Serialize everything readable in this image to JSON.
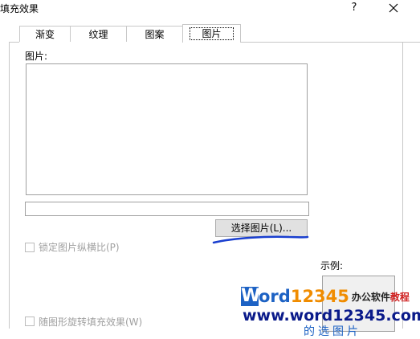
{
  "dialog": {
    "title": "填充效果",
    "help_label": "?",
    "close_label": "✕"
  },
  "tabs": [
    {
      "label": "渐变",
      "selected": false
    },
    {
      "label": "纹理",
      "selected": false
    },
    {
      "label": "图案",
      "selected": false
    },
    {
      "label": "图片",
      "selected": true
    }
  ],
  "picture": {
    "label": "图片:",
    "path_value": "",
    "choose_button": "选择图片(L)..."
  },
  "options": {
    "lock_aspect_label": "锁定图片纵横比(P)",
    "lock_aspect_checked": false,
    "rotate_with_shape_label": "随图形旋转填充效果(W)",
    "rotate_with_shape_checked": false
  },
  "sample": {
    "label": "示例:"
  },
  "watermark": {
    "logo_letter": "W",
    "brand_blue": "ord",
    "brand_orange": "12345",
    "sub_dark": "办公软件",
    "sub_red": "教程",
    "url": "www.word12345.com",
    "tail": "的选图片"
  },
  "colors": {
    "brand_blue": "#1d62c4",
    "brand_orange": "#f08c00",
    "annotation_underline": "#1a3fcf"
  }
}
